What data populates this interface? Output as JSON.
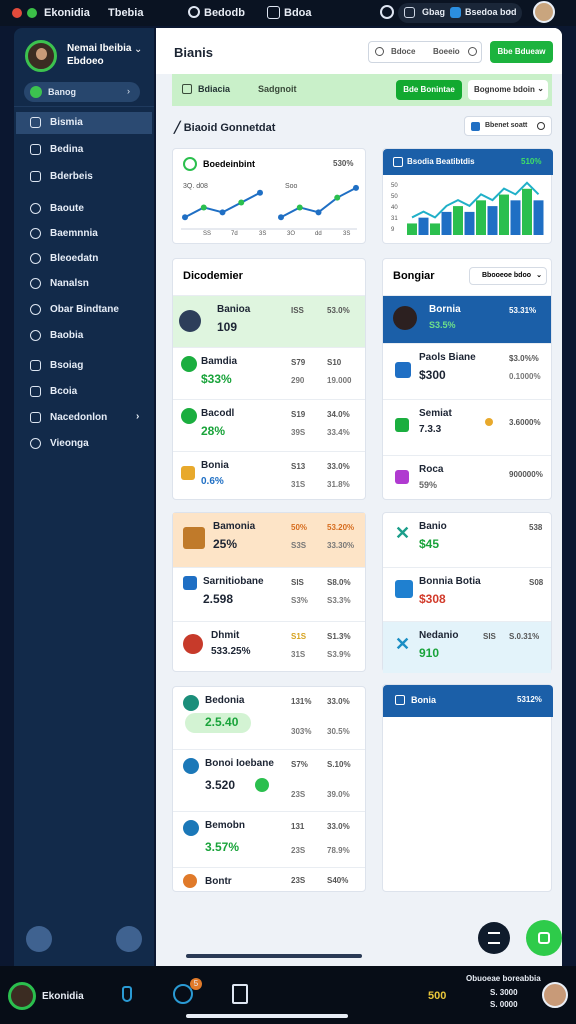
{
  "topbar": {
    "app_name": "Ekonidia",
    "item1": "Tbebia",
    "item2": "Bedodb",
    "item3": "Bdoa",
    "pill": "Gbag",
    "pill2": "Bsedoa bod"
  },
  "sidebar": {
    "user_name": "Nemai Ibeibia",
    "user_sub": "Ebdoeo",
    "selector": "Banog",
    "items": [
      {
        "label": "Bismia",
        "icon": "display-icon"
      },
      {
        "label": "Bedina",
        "icon": "document-icon"
      },
      {
        "label": "Bderbeis",
        "icon": "folder-icon"
      },
      {
        "label": "Baoute",
        "icon": "chat-icon"
      },
      {
        "label": "Baemnnia",
        "icon": "globe-icon"
      },
      {
        "label": "Bleoedatn",
        "icon": "gear-icon"
      },
      {
        "label": "Nanalsn",
        "icon": "star-icon"
      },
      {
        "label": "Obar Bindtane",
        "icon": "clock-icon"
      },
      {
        "label": "Baobia",
        "icon": "circle-icon"
      },
      {
        "label": "Bsoiag",
        "icon": "card-icon"
      },
      {
        "label": "Bcoia",
        "icon": "bag-icon"
      },
      {
        "label": "Nacedonlon",
        "icon": "tag-icon"
      },
      {
        "label": "Vieonga",
        "icon": "eye-icon"
      }
    ]
  },
  "header": {
    "title": "Bianis",
    "search_placeholder": "Bdoce",
    "search_hint": "Boeeio",
    "primary_button": "Bbe Bdueaw"
  },
  "greenbar": {
    "label1": "Bdiacia",
    "label2": "Sadgnoit",
    "button": "Bde Bonintae",
    "select": "Bognome bdoin"
  },
  "section": {
    "title": "Biaoid Gonnetdat",
    "button": "Bbenet soatt"
  },
  "chart_card1": {
    "title": "Boedeinbint",
    "value": "530%",
    "label_a": "3Q. d08",
    "label_b": "Soo",
    "ticks": [
      "SS",
      "7d",
      "3S",
      "3Q",
      "dd",
      "3S"
    ]
  },
  "chart_card2": {
    "title": "Bsodia Beatibtdis",
    "value": "510%",
    "ylabels": [
      "50",
      "50",
      "40",
      "31",
      "9"
    ]
  },
  "chart_data": [
    {
      "type": "line",
      "title": "Boedeinbint",
      "series": [
        {
          "name": "",
          "values": [
            2,
            4,
            3,
            5,
            7
          ]
        },
        {
          "name": "",
          "values": [
            2,
            4,
            3,
            6,
            8
          ]
        }
      ]
    },
    {
      "type": "bar",
      "title": "Bsodia Beatibtdis",
      "values": [
        2,
        3,
        2,
        4,
        5,
        4,
        6,
        5,
        7,
        6,
        8,
        6
      ]
    }
  ],
  "list_left": {
    "title": "Dicodemier",
    "rows": [
      {
        "title": "Banioa",
        "value": "109",
        "c1": "ISS",
        "c2": "53.0%",
        "d1": "",
        "d2": ""
      },
      {
        "title": "Bamdia",
        "value": "$33%",
        "c1": "S79",
        "c2": "S10",
        "d1": "290",
        "d2": "19.000"
      },
      {
        "title": "Bacodl",
        "value": "28%",
        "c1": "S19",
        "c2": "34.0%",
        "d1": "39S",
        "d2": "33.4%"
      },
      {
        "title": "Bonia",
        "value": "0.6%",
        "c1": "S13",
        "c2": "33.0%",
        "d1": "31S",
        "d2": "31.8%"
      }
    ]
  },
  "list_right": {
    "title": "Bongiar",
    "select": "Bbooeoe bdoo",
    "rows": [
      {
        "title": "Bornia",
        "value": "S3.5%",
        "c2": "53.31%"
      },
      {
        "title": "Paols Biane",
        "value": "$300",
        "c2": "$3.0%%",
        "d2": "0.1000%"
      },
      {
        "title": "Semiat",
        "value": "7.3.3",
        "c2": "3.6000%"
      },
      {
        "title": "Roca",
        "value": "59%",
        "c2": "900000%"
      }
    ]
  },
  "list_left2": {
    "rows": [
      {
        "title": "Bamonia",
        "value": "25%",
        "c1": "50%",
        "c2": "53.20%",
        "d1": "S3S",
        "d2": "33.30%"
      },
      {
        "title": "Sarnitiobane",
        "value": "2.598",
        "c1": "SIS",
        "c2": "S8.0%",
        "d1": "S3%",
        "d2": "S3.3%"
      },
      {
        "title": "Dhmit",
        "value": "533.25%",
        "c1": "S1S",
        "c2": "S1.3%",
        "d1": "31S",
        "d2": "S3.9%"
      }
    ]
  },
  "list_right2": {
    "rows": [
      {
        "title": "Banio",
        "value": "$45",
        "c2": "538"
      },
      {
        "title": "Bonnia Botia",
        "value": "$308",
        "c2": "S08"
      },
      {
        "title": "Nedanio",
        "value": "910",
        "c1": "SIS",
        "c2": "S.0.31%"
      }
    ]
  },
  "list_left3": {
    "rows": [
      {
        "title": "Bedonia",
        "value": "2.5.40",
        "c1": "131%",
        "c2": "33.0%",
        "d1": "303%",
        "d2": "30.5%"
      },
      {
        "title": "Bonoi Ioebane",
        "value": "3.520",
        "c1": "S7%",
        "c2": "S.10%",
        "d1": "23S",
        "d2": "39.0%"
      },
      {
        "title": "Bemobn",
        "value": "3.57%",
        "c1": "131",
        "c2": "33.0%",
        "d1": "23S",
        "d2": "78.9%"
      },
      {
        "title": "Bontr",
        "value": "",
        "c1": "23S",
        "c2": "S40%",
        "d1": "",
        "d2": ""
      }
    ]
  },
  "panel_right3": {
    "title": "Bonia",
    "value": "5312%"
  },
  "bottombar": {
    "app_name": "Ekonidia",
    "badge": "5",
    "amount": "500",
    "info_line1": "Obuoeae boreabbia",
    "info_line2": "S. 3000",
    "info_line3": "S. 0000"
  }
}
